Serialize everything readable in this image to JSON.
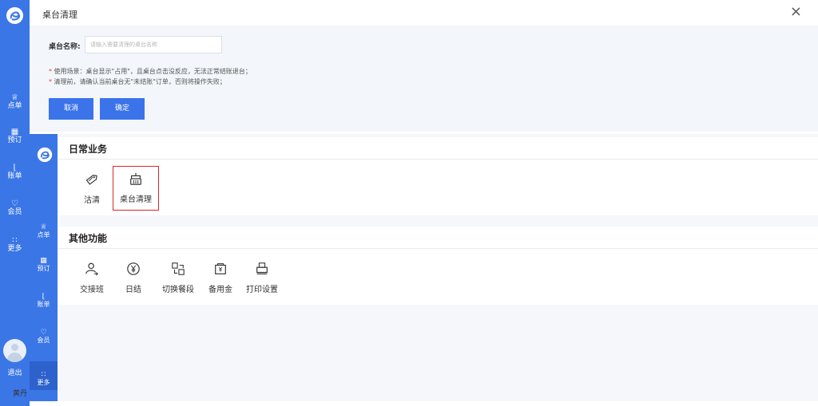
{
  "dialog": {
    "title": "桌台清理",
    "field_label": "桌台名称:",
    "field_placeholder": "请输入需要清理的桌台名称",
    "notes": [
      "使用场景：桌台显示\"占用\"，且桌台点击没反应，无法正常结账退台；",
      "清理前，请确认当前桌台无\"未结账\"订单，否则将操作失败；"
    ],
    "note_marker": "*",
    "cancel_label": "取消",
    "confirm_label": "确定",
    "close_symbol": "×"
  },
  "back_sidebar": {
    "items": [
      {
        "icon": "crown-icon",
        "label": "点单"
      },
      {
        "icon": "calendar-icon",
        "label": "预订"
      },
      {
        "icon": "chart-icon",
        "label": "账单"
      },
      {
        "icon": "member-icon",
        "label": "会员"
      },
      {
        "icon": "more-icon",
        "label": "更多"
      }
    ],
    "logout_label": "退出",
    "user_name": "黄丹"
  },
  "front_sidebar": {
    "items": [
      {
        "icon": "crown-icon",
        "label": "点单"
      },
      {
        "icon": "more-icon",
        "label": "更多"
      },
      {
        "icon": "calendar-icon",
        "label": "预订"
      },
      {
        "icon": "chart-icon",
        "label": "账单"
      },
      {
        "icon": "member-icon",
        "label": "会员"
      },
      {
        "icon": "more-icon",
        "label": "更多"
      }
    ]
  },
  "daily": {
    "title": "日常业务",
    "items": [
      {
        "icon": "tag-icon",
        "label": "沽清"
      },
      {
        "icon": "broom-icon",
        "label": "桌台清理"
      }
    ]
  },
  "other": {
    "title": "其他功能",
    "items": [
      {
        "icon": "handover-icon",
        "label": "交接班"
      },
      {
        "icon": "yen-icon",
        "label": "日结"
      },
      {
        "icon": "switch-icon",
        "label": "切换餐段"
      },
      {
        "icon": "wallet-icon",
        "label": "备用金"
      },
      {
        "icon": "printer-icon",
        "label": "打印设置"
      }
    ]
  },
  "colors": {
    "brand": "#3a76e6",
    "primary_button": "#3b73ea",
    "selected_border": "#d92727",
    "note_marker": "#f03c3c"
  }
}
